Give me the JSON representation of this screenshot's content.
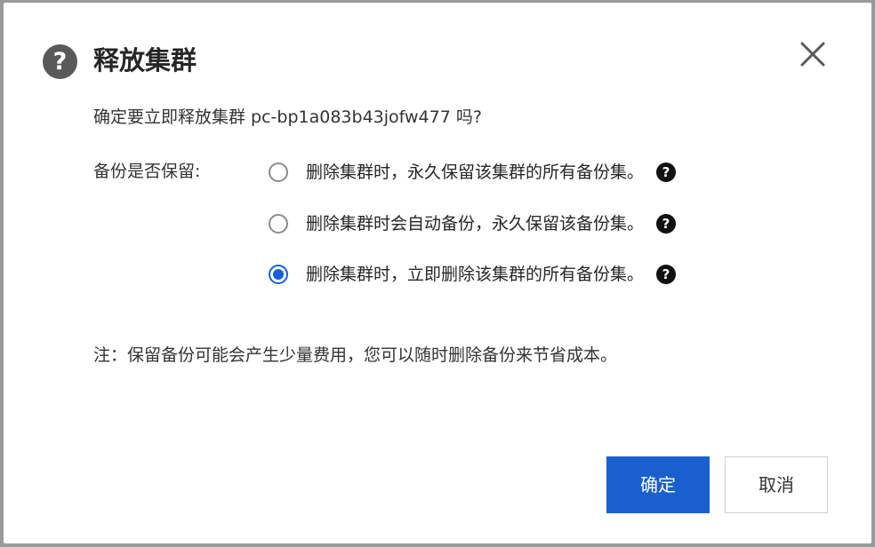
{
  "dialog": {
    "title": "释放集群",
    "confirm_text": "确定要立即释放集群 pc-bp1a083b43jofw477 吗?",
    "backup_label": "备份是否保留:",
    "options": [
      {
        "label": "删除集群时，永久保留该集群的所有备份集。",
        "checked": false
      },
      {
        "label": "删除集群时会自动备份，永久保留该备份集。",
        "checked": false
      },
      {
        "label": "删除集群时，立即删除该集群的所有备份集。",
        "checked": true
      }
    ],
    "note": "注：保留备份可能会产生少量费用，您可以随时删除备份来节省成本。",
    "ok_label": "确定",
    "cancel_label": "取消",
    "question_glyph": "?"
  },
  "colors": {
    "primary": "#1a5fce",
    "radio_checked": "#1660d9",
    "title_icon_bg": "#595959"
  },
  "icons": {
    "title": "question-circle-icon",
    "close": "close-x-icon",
    "help": "question-circle-filled-icon"
  }
}
